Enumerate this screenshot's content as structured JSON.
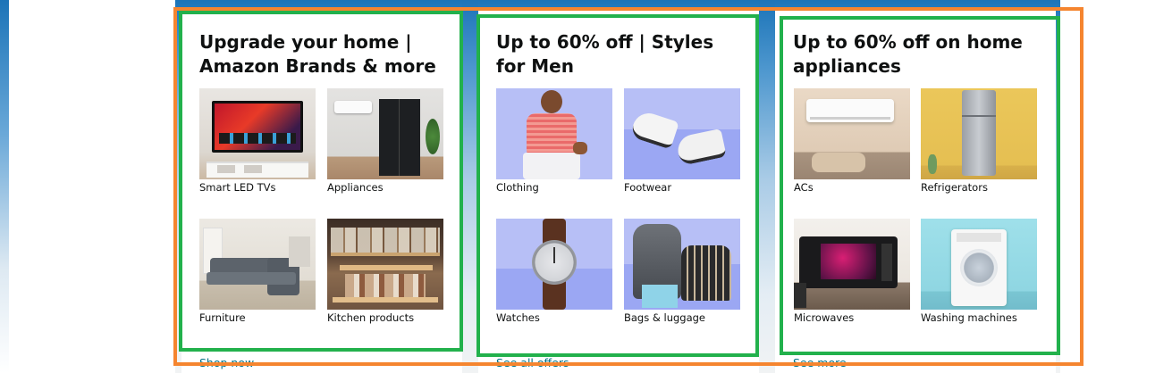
{
  "cards": [
    {
      "title": "Upgrade your home | Amazon Brands & more",
      "link": "Shop now",
      "tiles": [
        {
          "label": "Smart LED TVs",
          "image": "smart-tv-image"
        },
        {
          "label": "Appliances",
          "image": "appliances-image"
        },
        {
          "label": "Furniture",
          "image": "sofa-image"
        },
        {
          "label": "Kitchen products",
          "image": "kitchen-jars-image"
        }
      ]
    },
    {
      "title": "Up to 60% off | Styles for Men",
      "link": "See all offers",
      "tiles": [
        {
          "label": "Clothing",
          "image": "man-in-shirt-image"
        },
        {
          "label": "Footwear",
          "image": "sneakers-image"
        },
        {
          "label": "Watches",
          "image": "wristwatch-image"
        },
        {
          "label": "Bags & luggage",
          "image": "backpack-image"
        }
      ]
    },
    {
      "title": "Up to 60% off on home appliances",
      "link": "See more",
      "tiles": [
        {
          "label": "ACs",
          "image": "air-conditioner-image"
        },
        {
          "label": "Refrigerators",
          "image": "refrigerator-image"
        },
        {
          "label": "Microwaves",
          "image": "microwave-image"
        },
        {
          "label": "Washing machines",
          "image": "washing-machine-image"
        }
      ]
    }
  ],
  "colors": {
    "annotation_green": "#22b14c",
    "annotation_orange": "#f5852f",
    "link": "#007185",
    "tile_purple": "#a9b5f5"
  }
}
